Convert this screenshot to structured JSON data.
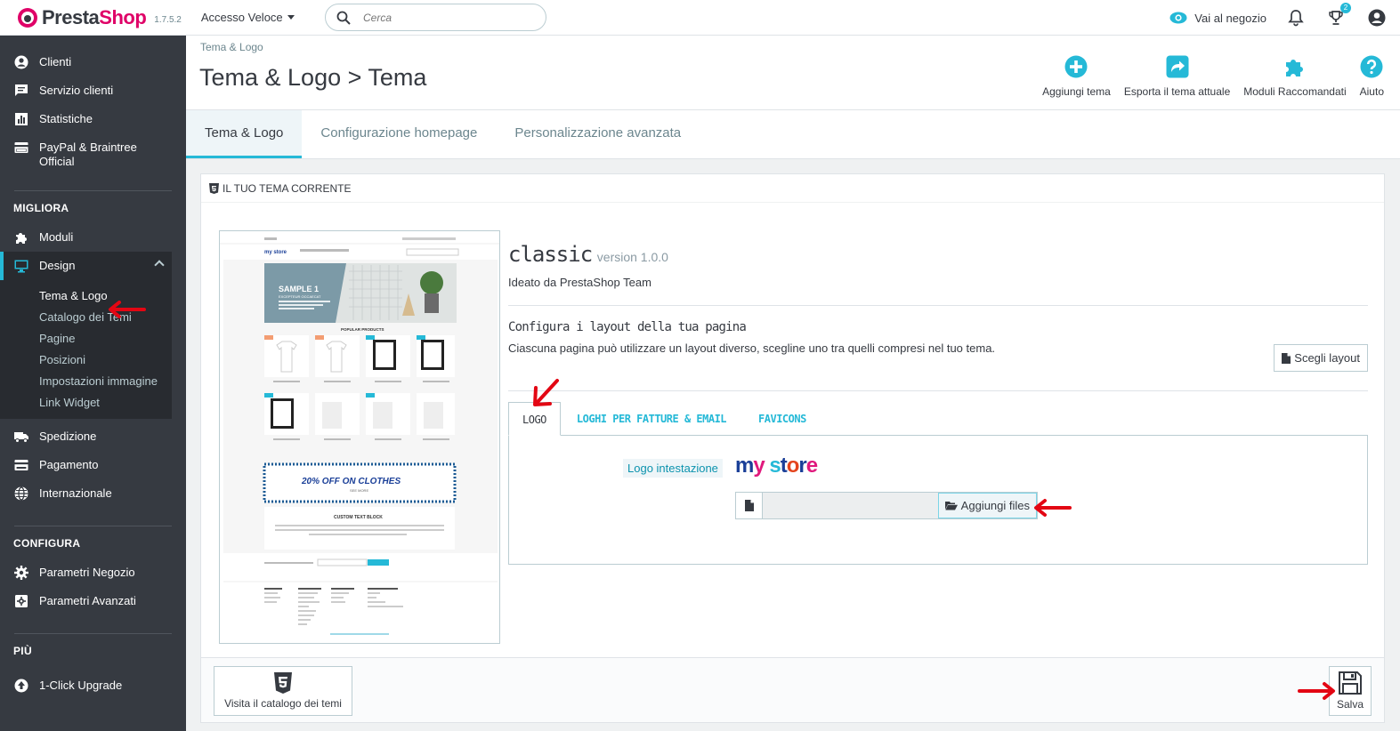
{
  "header": {
    "logo_text": "PrestaShop",
    "logo_text_a": "Presta",
    "logo_text_b": "Shop",
    "version": "1.7.5.2",
    "quick_access": "Accesso Veloce",
    "search_placeholder": "Cerca",
    "shop_link": "Vai al negozio",
    "notif_count": "2"
  },
  "sidebar": {
    "items_top": [
      {
        "label": "Clienti",
        "icon": "user-icon"
      },
      {
        "label": "Servizio clienti",
        "icon": "chat-icon"
      },
      {
        "label": "Statistiche",
        "icon": "stats-icon"
      },
      {
        "label": "PayPal & Braintree Official",
        "icon": "card-icon"
      }
    ],
    "section_improve": "MIGLIORA",
    "modules": "Moduli",
    "design": "Design",
    "design_sub": [
      "Tema & Logo",
      "Catalogo dei Temi",
      "Pagine",
      "Posizioni",
      "Impostazioni immagine",
      "Link Widget"
    ],
    "shipping": "Spedizione",
    "payment": "Pagamento",
    "intl": "Internazionale",
    "section_configure": "CONFIGURA",
    "shop_params": "Parametri Negozio",
    "adv_params": "Parametri Avanzati",
    "section_more": "PIÙ",
    "upgrade": "1-Click Upgrade"
  },
  "page": {
    "breadcrumb": "Tema & Logo",
    "title": "Tema & Logo > Tema",
    "toolbar": [
      "Aggiungi tema",
      "Esporta il tema attuale",
      "Moduli Raccomandati",
      "Aiuto"
    ]
  },
  "tabs": [
    "Tema & Logo",
    "Configurazione homepage",
    "Personalizzazione avanzata"
  ],
  "panel": {
    "heading": "IL TUO TEMA CORRENTE",
    "theme_name": "classic",
    "theme_version": "version 1.0.0",
    "author": "Ideato da PrestaShop Team",
    "layout_title": "Configura i layout della tua pagina",
    "layout_desc": "Ciascuna pagina può utilizzare un layout diverso, scegline uno tra quelli compresi nel tuo tema.",
    "layout_button": "Scegli layout",
    "logo_tabs": [
      "LOGO",
      "LOGHI PER FATTURE & EMAIL",
      "FAVICONS"
    ],
    "logo_label": "Logo intestazione",
    "store_logo": "my store",
    "add_files": "Aggiungi files",
    "catalog_button": "Visita il catalogo dei temi",
    "save_button": "Salva"
  },
  "preview": {
    "banner_title": "SAMPLE 1",
    "banner_sub": "EXCEPTEUR OCCAECAT",
    "popular": "POPULAR PRODUCTS",
    "promo": "20% OFF ON CLOTHES",
    "promo_sub": "SEE MORE",
    "custom_block": "CUSTOM TEXT BLOCK",
    "store_name": "my store"
  },
  "colors": {
    "accent": "#25b9d7",
    "brand": "#df0067",
    "sidebar": "#363a41",
    "arrow": "#e30613"
  }
}
